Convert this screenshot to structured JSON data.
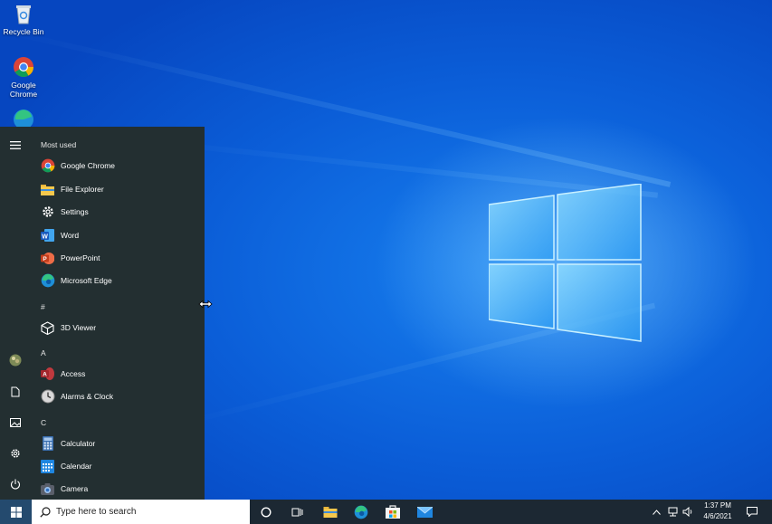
{
  "desktop": {
    "icons": [
      {
        "label": "Recycle Bin",
        "icon": "recycle-bin-icon"
      },
      {
        "label": "Google Chrome",
        "icon": "chrome-icon"
      },
      {
        "label": "",
        "icon": "edge-icon"
      }
    ]
  },
  "start_menu": {
    "most_used_header": "Most used",
    "most_used": [
      {
        "label": "Google Chrome",
        "icon": "chrome-icon"
      },
      {
        "label": "File Explorer",
        "icon": "folder-icon"
      },
      {
        "label": "Settings",
        "icon": "gear-icon"
      },
      {
        "label": "Word",
        "icon": "word-icon"
      },
      {
        "label": "PowerPoint",
        "icon": "powerpoint-icon"
      },
      {
        "label": "Microsoft Edge",
        "icon": "edge-icon"
      }
    ],
    "groups": [
      {
        "letter": "#",
        "apps": [
          {
            "label": "3D Viewer",
            "icon": "cube-icon"
          }
        ]
      },
      {
        "letter": "A",
        "apps": [
          {
            "label": "Access",
            "icon": "access-icon"
          },
          {
            "label": "Alarms & Clock",
            "icon": "clock-icon"
          }
        ]
      },
      {
        "letter": "C",
        "apps": [
          {
            "label": "Calculator",
            "icon": "calculator-icon"
          },
          {
            "label": "Calendar",
            "icon": "calendar-icon"
          },
          {
            "label": "Camera",
            "icon": "camera-icon"
          }
        ]
      }
    ],
    "rail": [
      "hamburger-icon",
      "avatar",
      "document-icon",
      "pictures-icon",
      "gear-icon",
      "power-icon"
    ]
  },
  "taskbar": {
    "search_placeholder": "Type here to search",
    "pinned": [
      "cortana-icon",
      "task-view-icon",
      "file-explorer-icon",
      "edge-icon",
      "store-icon",
      "mail-icon"
    ],
    "time": "1:37 PM",
    "date": "4/6/2021"
  },
  "colors": {
    "start_bg": "#232f31",
    "taskbar_bg": "#1c2833",
    "desktop_blue": "#0b5ed8"
  }
}
